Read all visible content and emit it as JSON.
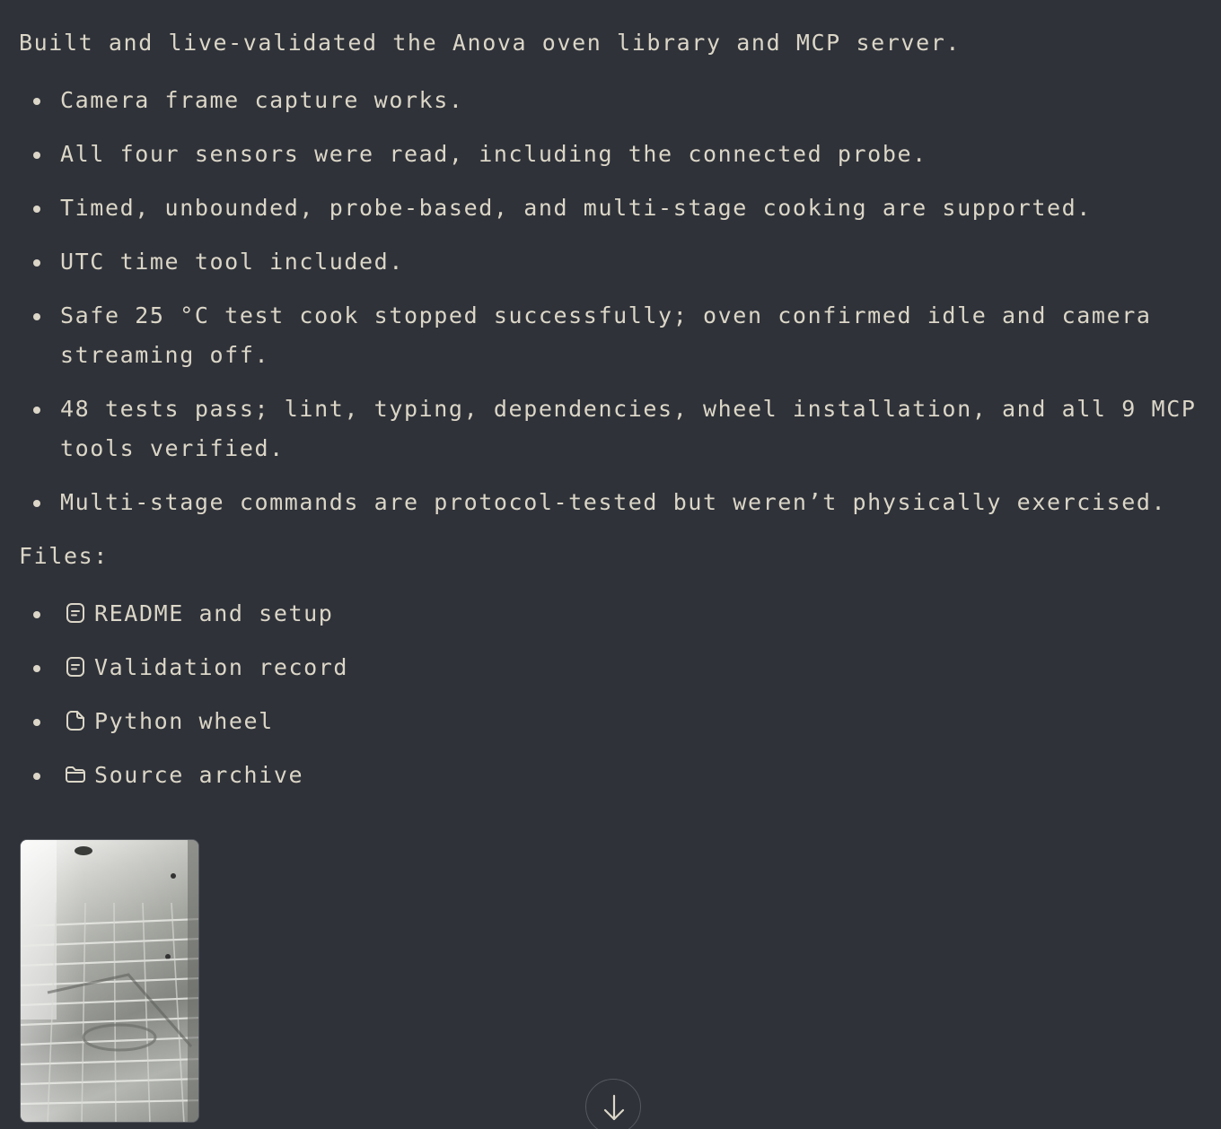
{
  "message": {
    "summary": "Built and live-validated the Anova oven library and MCP server.",
    "bullets": [
      "Camera frame capture works.",
      "All four sensors were read, including the connected probe.",
      "Timed, unbounded, probe-based, and multi-stage cooking are supported.",
      "UTC time tool included.",
      "Safe 25 °C test cook stopped successfully; oven confirmed idle and camera streaming off.",
      "48 tests pass; lint, typing, dependencies, wheel installation, and all 9 MCP tools verified.",
      "Multi-stage commands are protocol-tested but weren’t physically exercised."
    ],
    "files_label": "Files:",
    "files": [
      {
        "label": "README and setup",
        "icon": "document-icon"
      },
      {
        "label": "Validation record",
        "icon": "document-icon"
      },
      {
        "label": "Python wheel",
        "icon": "file-icon"
      },
      {
        "label": "Source archive",
        "icon": "folder-icon"
      }
    ],
    "image": {
      "content": "oven-camera-frame"
    }
  },
  "controls": {
    "scroll_button_icon": "arrow-down-icon"
  },
  "colors": {
    "background": "#2f3239",
    "text": "#dbd6c7",
    "border": "#55585f"
  }
}
